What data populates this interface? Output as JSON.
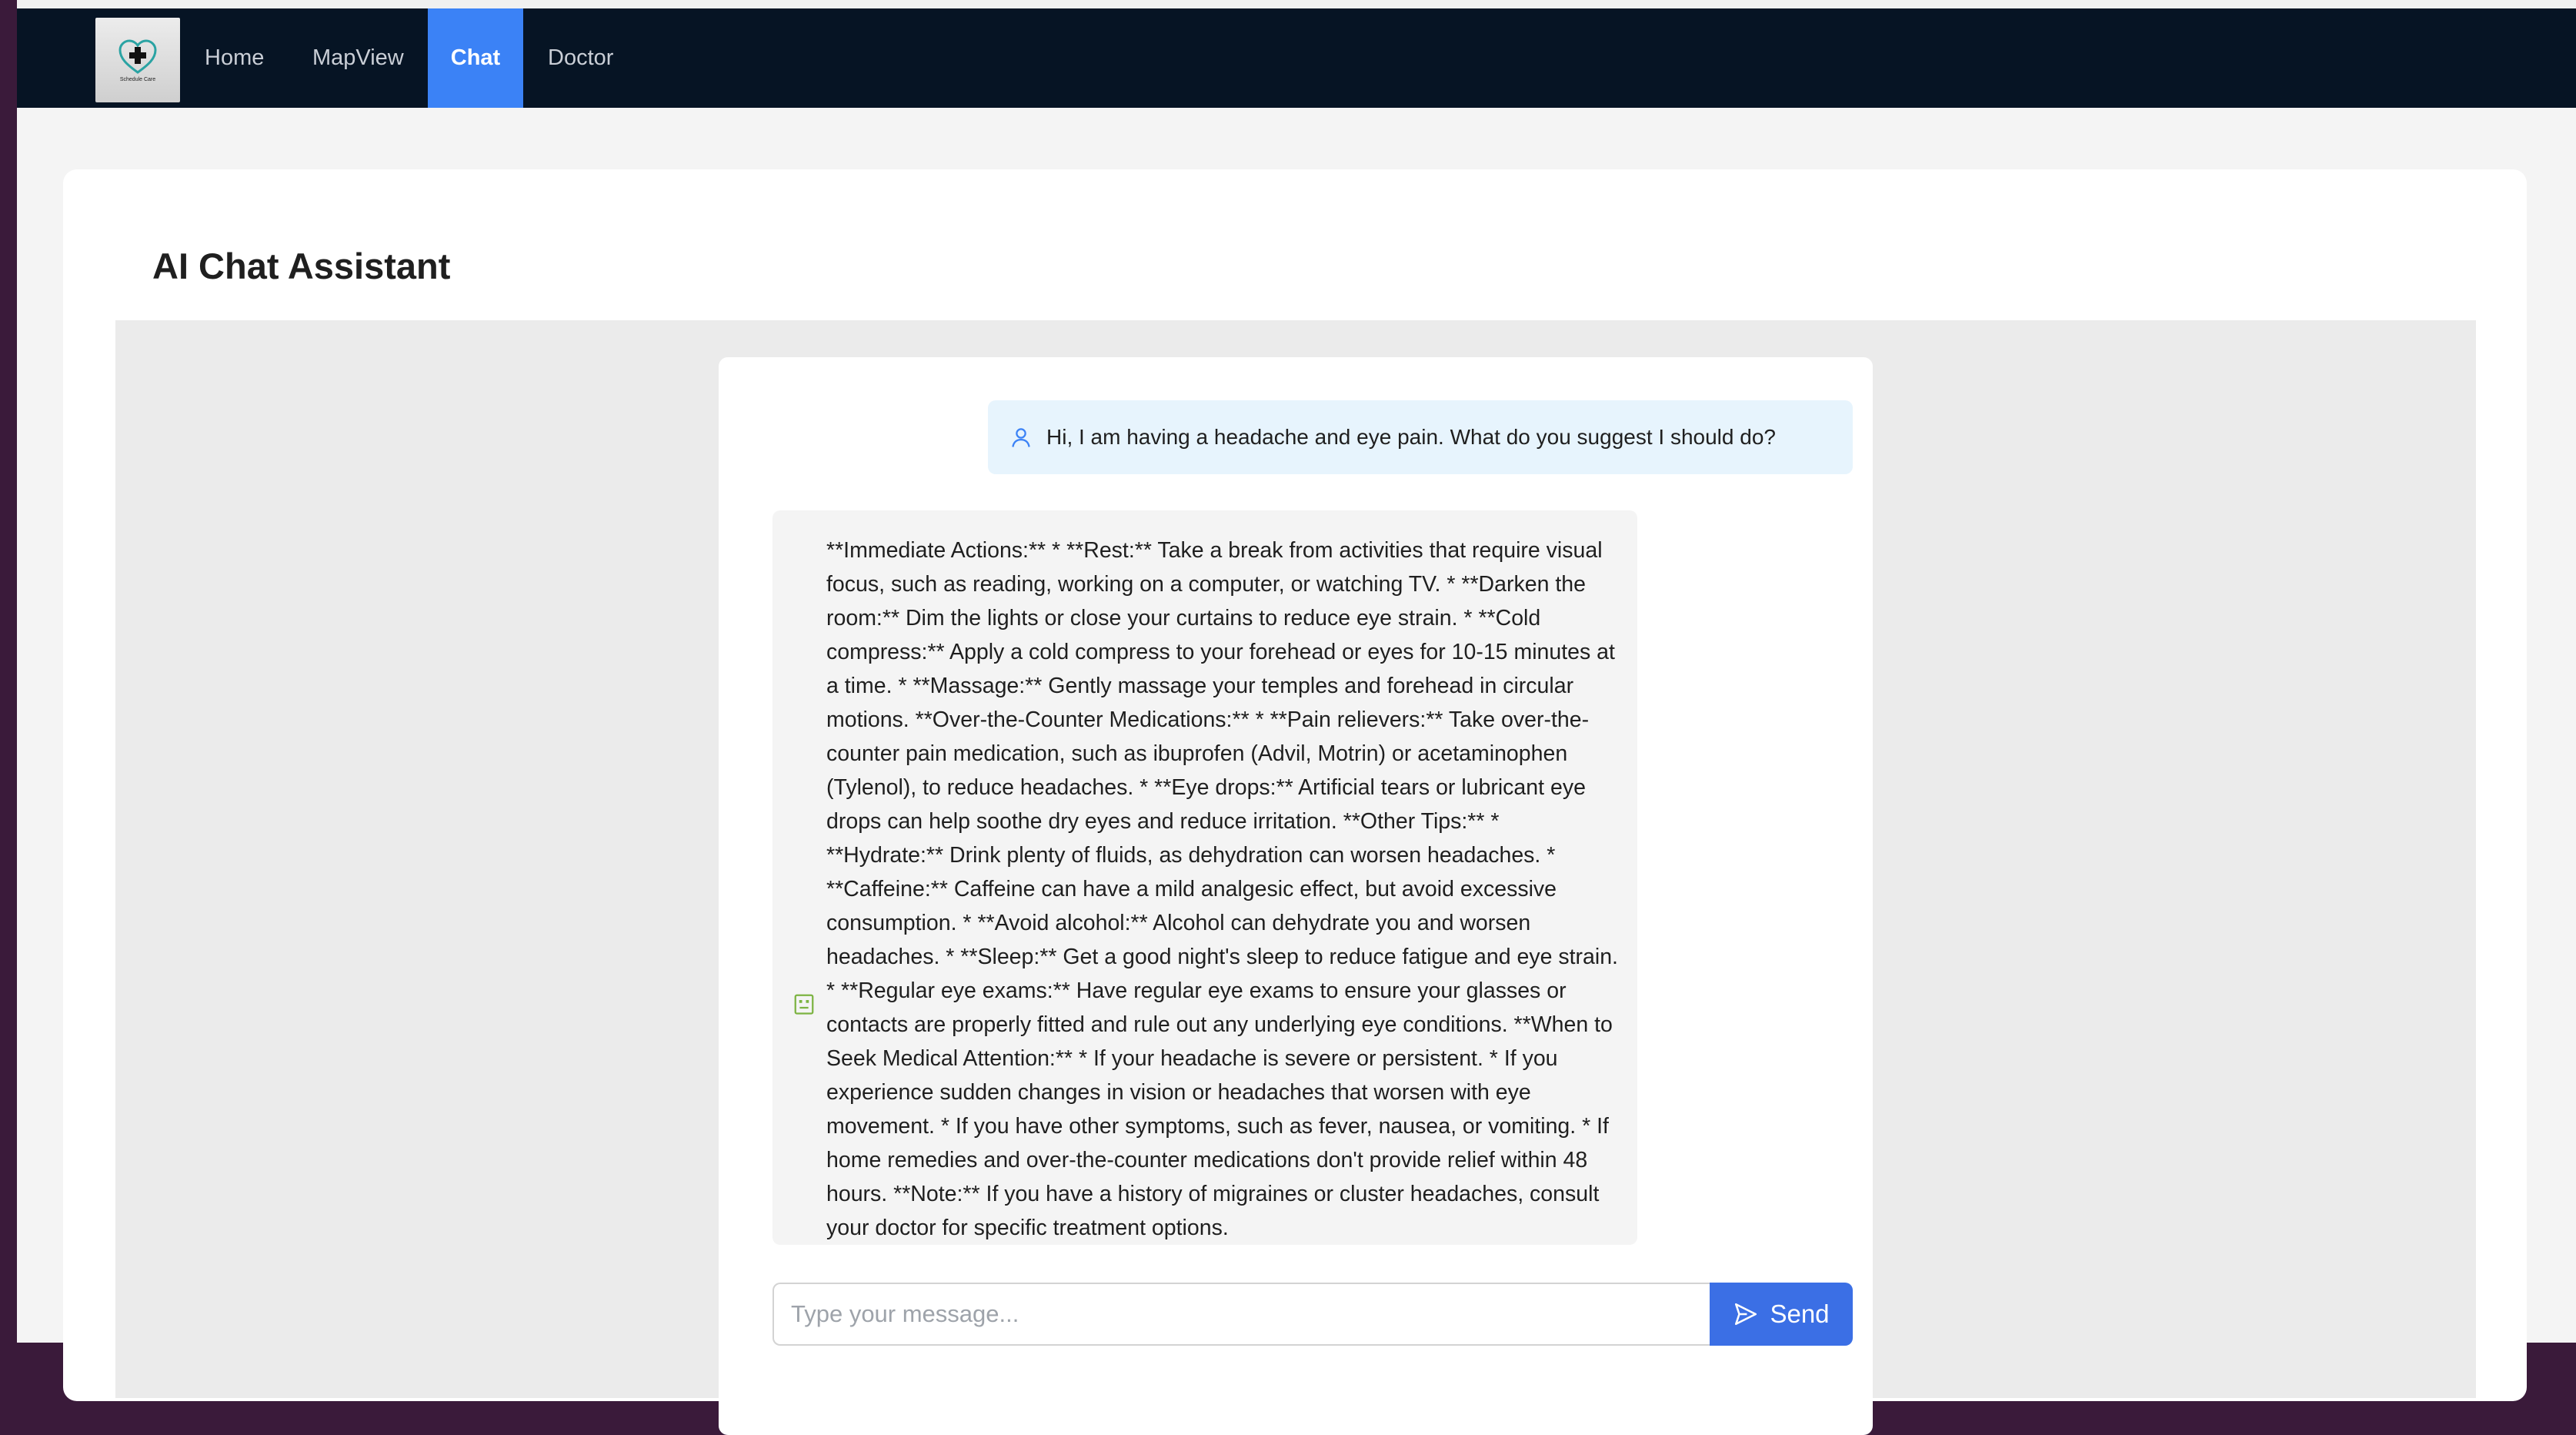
{
  "nav": {
    "logo_text": "Schedule Care",
    "items": [
      {
        "label": "Home",
        "active": false
      },
      {
        "label": "MapView",
        "active": false
      },
      {
        "label": "Chat",
        "active": true
      },
      {
        "label": "Doctor",
        "active": false
      }
    ]
  },
  "page": {
    "title": "AI Chat Assistant"
  },
  "chat": {
    "messages": [
      {
        "role": "user",
        "icon": "user-icon",
        "text": "Hi, I am having a headache and eye pain. What do you suggest I should do?"
      },
      {
        "role": "assistant",
        "icon": "robot-icon",
        "text": "**Immediate Actions:** * **Rest:** Take a break from activities that require visual focus, such as reading, working on a computer, or watching TV. * **Darken the room:** Dim the lights or close your curtains to reduce eye strain. * **Cold compress:** Apply a cold compress to your forehead or eyes for 10-15 minutes at a time. * **Massage:** Gently massage your temples and forehead in circular motions. **Over-the-Counter Medications:** * **Pain relievers:** Take over-the-counter pain medication, such as ibuprofen (Advil, Motrin) or acetaminophen (Tylenol), to reduce headaches. * **Eye drops:** Artificial tears or lubricant eye drops can help soothe dry eyes and reduce irritation. **Other Tips:** * **Hydrate:** Drink plenty of fluids, as dehydration can worsen headaches. * **Caffeine:** Caffeine can have a mild analgesic effect, but avoid excessive consumption. * **Avoid alcohol:** Alcohol can dehydrate you and worsen headaches. * **Sleep:** Get a good night's sleep to reduce fatigue and eye strain. * **Regular eye exams:** Have regular eye exams to ensure your glasses or contacts are properly fitted and rule out any underlying eye conditions. **When to Seek Medical Attention:** * If your headache is severe or persistent. * If you experience sudden changes in vision or headaches that worsen with eye movement. * If you have other symptoms, such as fever, nausea, or vomiting. * If home remedies and over-the-counter medications don't provide relief within 48 hours. **Note:** If you have a history of migraines or cluster headaches, consult your doctor for specific treatment options."
      }
    ],
    "input": {
      "value": "",
      "placeholder": "Type your message..."
    },
    "send_label": "Send",
    "send_icon": "send-icon"
  },
  "colors": {
    "navbar_bg": "#061424",
    "accent": "#3b82f6",
    "user_bubble": "#e7f4fd",
    "bot_bubble": "#f4f4f4",
    "bot_icon": "#7cb342",
    "user_icon": "#3b82f6"
  }
}
